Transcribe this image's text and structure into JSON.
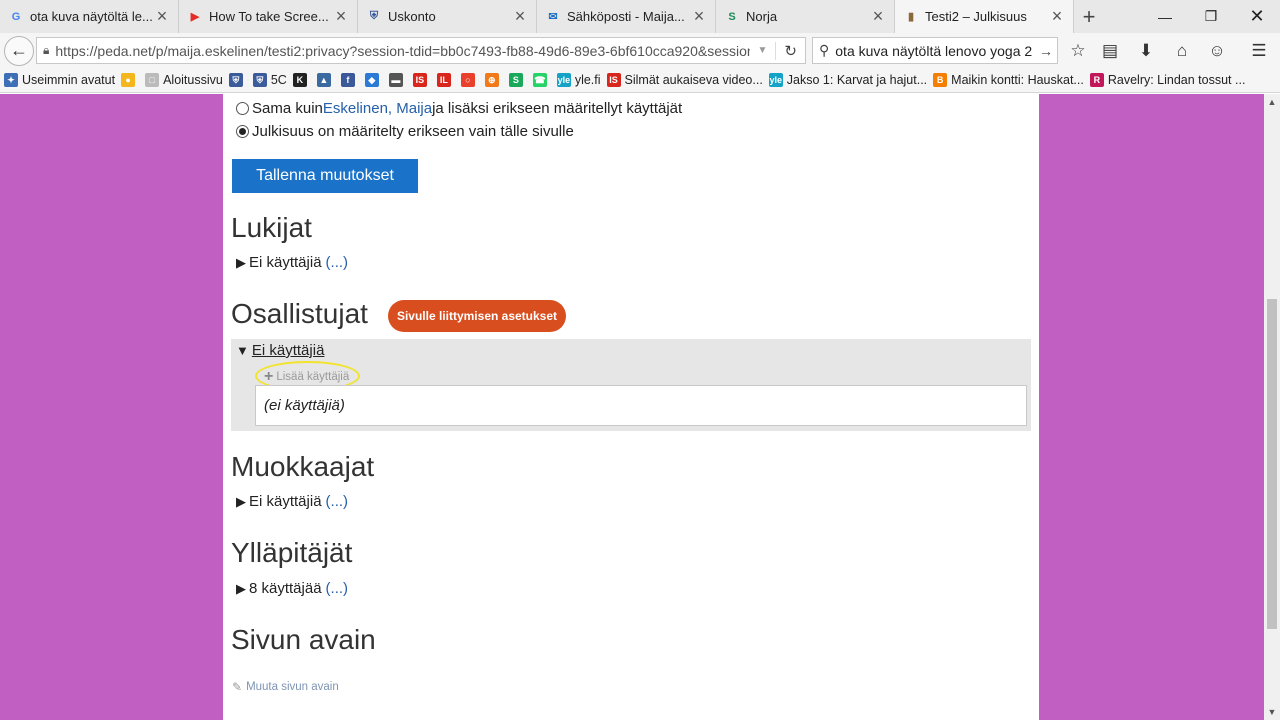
{
  "browser": {
    "tabs": [
      {
        "title": "ota kuva näytöltä le...",
        "icon": "google-icon",
        "icon_glyph": "G",
        "icon_color": "#4285f4",
        "active": false
      },
      {
        "title": "How To take Scree...",
        "icon": "youtube-icon",
        "icon_glyph": "▶",
        "icon_color": "#e52d27",
        "active": false
      },
      {
        "title": "Uskonto",
        "icon": "shield-icon",
        "icon_glyph": "⛨",
        "icon_color": "#3b5b9a",
        "active": false
      },
      {
        "title": "Sähköposti - Maija...",
        "icon": "mail-icon",
        "icon_glyph": "✉",
        "icon_color": "#1a6fc7",
        "active": false
      },
      {
        "title": "Norja",
        "icon": "sway-icon",
        "icon_glyph": "S",
        "icon_color": "#1d8a5b",
        "active": false
      },
      {
        "title": "Testi2 – Julkisuus",
        "icon": "page-icon",
        "icon_glyph": "▮",
        "icon_color": "#8a6a3a",
        "active": true
      }
    ],
    "url": "https://peda.net/p/maija.eskelinen/testi2:privacy?session-tdid=bb0c7493-fb88-49d6-89e3-6bf610cca920&session",
    "search_query": "ota kuva näytöltä lenovo yoga 2",
    "bookmarks": [
      {
        "label": "Useimmin avatut",
        "icon_color": "#3c6fb5",
        "glyph": "✦"
      },
      {
        "label": "",
        "icon_color": "#f3b61c",
        "glyph": "●"
      },
      {
        "label": "Aloitussivu",
        "icon_color": "#bbbbbb",
        "glyph": "□"
      },
      {
        "label": "",
        "icon_color": "#3b5b9a",
        "glyph": "⛨"
      },
      {
        "label": "5C",
        "icon_color": "#3b5b9a",
        "glyph": "⛨"
      },
      {
        "label": "",
        "icon_color": "#222222",
        "glyph": "K"
      },
      {
        "label": "",
        "icon_color": "#3a6aa0",
        "glyph": "▲"
      },
      {
        "label": "",
        "icon_color": "#3b5998",
        "glyph": "f"
      },
      {
        "label": "",
        "icon_color": "#2b7bd6",
        "glyph": "◆"
      },
      {
        "label": "",
        "icon_color": "#555555",
        "glyph": "▬"
      },
      {
        "label": "",
        "icon_color": "#d9261c",
        "glyph": "IS"
      },
      {
        "label": "",
        "icon_color": "#d9261c",
        "glyph": "IL"
      },
      {
        "label": "",
        "icon_color": "#e8402a",
        "glyph": "○"
      },
      {
        "label": "",
        "icon_color": "#f07a1a",
        "glyph": "⊕"
      },
      {
        "label": "",
        "icon_color": "#1aa85a",
        "glyph": "S"
      },
      {
        "label": "",
        "icon_color": "#25d366",
        "glyph": "☎"
      },
      {
        "label": "yle.fi",
        "icon_color": "#14a3c7",
        "glyph": "yle"
      },
      {
        "label": "Silmät aukaiseva video...",
        "icon_color": "#d9261c",
        "glyph": "IS"
      },
      {
        "label": "Jakso 1: Karvat ja hajut...",
        "icon_color": "#14a3c7",
        "glyph": "yle"
      },
      {
        "label": "Maikin kontti: Hauskat...",
        "icon_color": "#f57d00",
        "glyph": "B"
      },
      {
        "label": "Ravelry: Lindan tossut ...",
        "icon_color": "#c2185b",
        "glyph": "R"
      }
    ]
  },
  "page": {
    "radio_options": [
      {
        "prefix": "Sama kuin ",
        "link": "Eskelinen, Maija",
        "suffix": " ja lisäksi erikseen määritellyt käyttäjät",
        "checked": false
      },
      {
        "prefix": "Julkisuus on määritelty erikseen vain tälle sivulle",
        "link": "",
        "suffix": "",
        "checked": true
      }
    ],
    "save_button": "Tallenna muutokset",
    "sections": {
      "lukijat": {
        "heading": "Lukijat",
        "summary": "Ei käyttäjiä",
        "more": "(...)"
      },
      "osallistujat": {
        "heading": "Osallistujat",
        "join_button": "Sivulle liittymisen asetukset",
        "summary": "Ei käyttäjiä",
        "add_label": "Lisää käyttäjiä",
        "empty_text": "(ei käyttäjiä)"
      },
      "muokkaajat": {
        "heading": "Muokkaajat",
        "summary": "Ei käyttäjiä",
        "more": "(...)"
      },
      "yllapitajat": {
        "heading": "Ylläpitäjät",
        "summary": "8 käyttäjää",
        "more": "(...)"
      },
      "sivun_avain": {
        "heading": "Sivun avain",
        "change_link": "Muuta sivun avain"
      }
    }
  }
}
